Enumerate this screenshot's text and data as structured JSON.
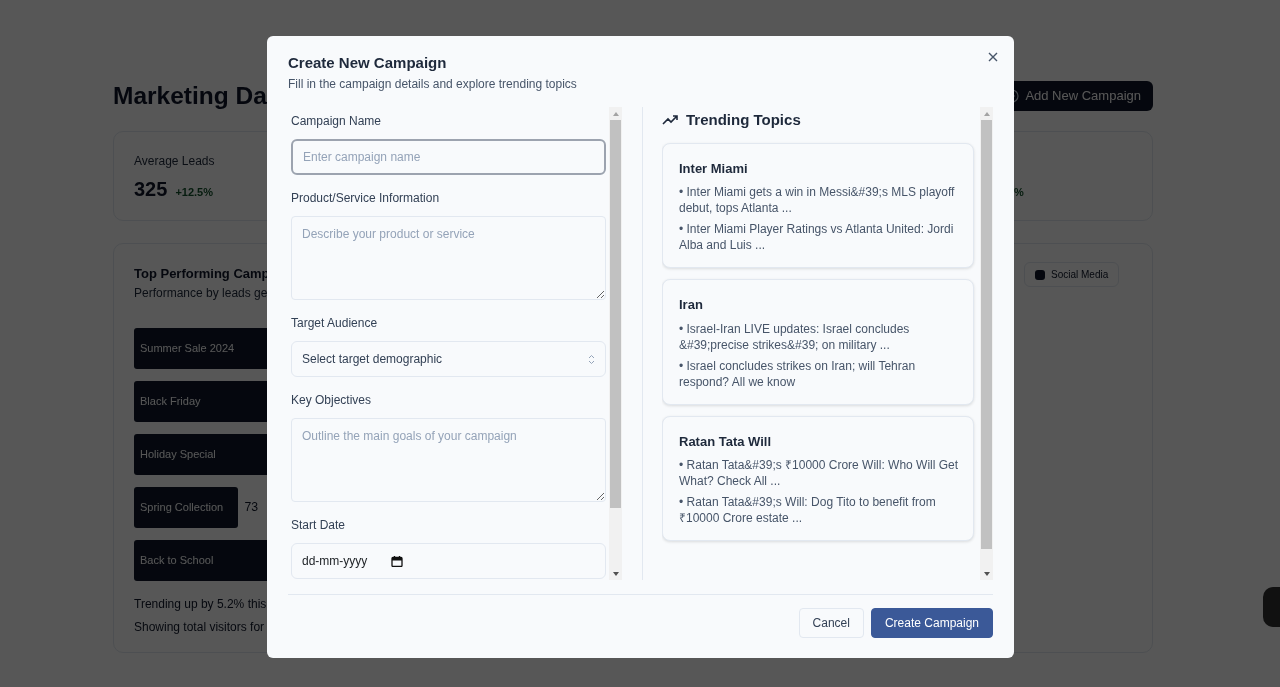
{
  "background": {
    "title": "Marketing Da",
    "add_button": "Add New Campaign",
    "stat": {
      "label": "Average Leads",
      "value": "325",
      "change": "+12.5%",
      "change_2": "%"
    },
    "chart_card": {
      "title": "Top Performing Camp",
      "subtitle": "Performance by leads ge",
      "filter": "Social Media",
      "bars": [
        {
          "label": "Summer Sale 2024"
        },
        {
          "label": "Black Friday"
        },
        {
          "label": "Holiday Special"
        },
        {
          "label": "Spring Collection",
          "value": "73"
        },
        {
          "label": "Back to School"
        }
      ],
      "footer": [
        "Trending up by 5.2% this",
        "Showing total visitors for"
      ]
    }
  },
  "modal": {
    "title": "Create New Campaign",
    "subtitle": "Fill in the campaign details and explore trending topics",
    "fields": [
      {
        "kind": "text",
        "label": "Campaign Name",
        "placeholder": "Enter campaign name",
        "focused": true
      },
      {
        "kind": "textarea",
        "label": "Product/Service Information",
        "placeholder": "Describe your product or service",
        "focused": false
      },
      {
        "kind": "select",
        "label": "Target Audience",
        "value": "Select target demographic",
        "focused": false
      },
      {
        "kind": "textarea",
        "label": "Key Objectives",
        "placeholder": "Outline the main goals of your campaign",
        "focused": false
      },
      {
        "kind": "date",
        "label": "Start Date",
        "value": "dd-mm-yyyy",
        "focused": false
      }
    ],
    "trending": {
      "title": "Trending Topics",
      "topics": [
        {
          "name": "Inter Miami",
          "items": [
            "• Inter Miami gets a win in Messi&#39;s MLS playoff debut, tops Atlanta ...",
            "• Inter Miami Player Ratings vs Atlanta United: Jordi Alba and Luis ..."
          ]
        },
        {
          "name": "Iran",
          "items": [
            "• Israel-Iran LIVE updates: Israel concludes &#39;precise strikes&#39; on military ...",
            "• Israel concludes strikes on Iran; will Tehran respond? All we know"
          ]
        },
        {
          "name": "Ratan Tata Will",
          "items": [
            "• Ratan Tata&#39;s ₹10000 Crore Will: Who Will Get What? Check All ...",
            "• Ratan Tata&#39;s Will: Dog Tito to benefit from ₹10000 Crore estate ..."
          ]
        }
      ]
    },
    "buttons": [
      {
        "label": "Cancel",
        "kind": "secondary"
      },
      {
        "label": "Create Campaign",
        "kind": "primary"
      }
    ]
  }
}
